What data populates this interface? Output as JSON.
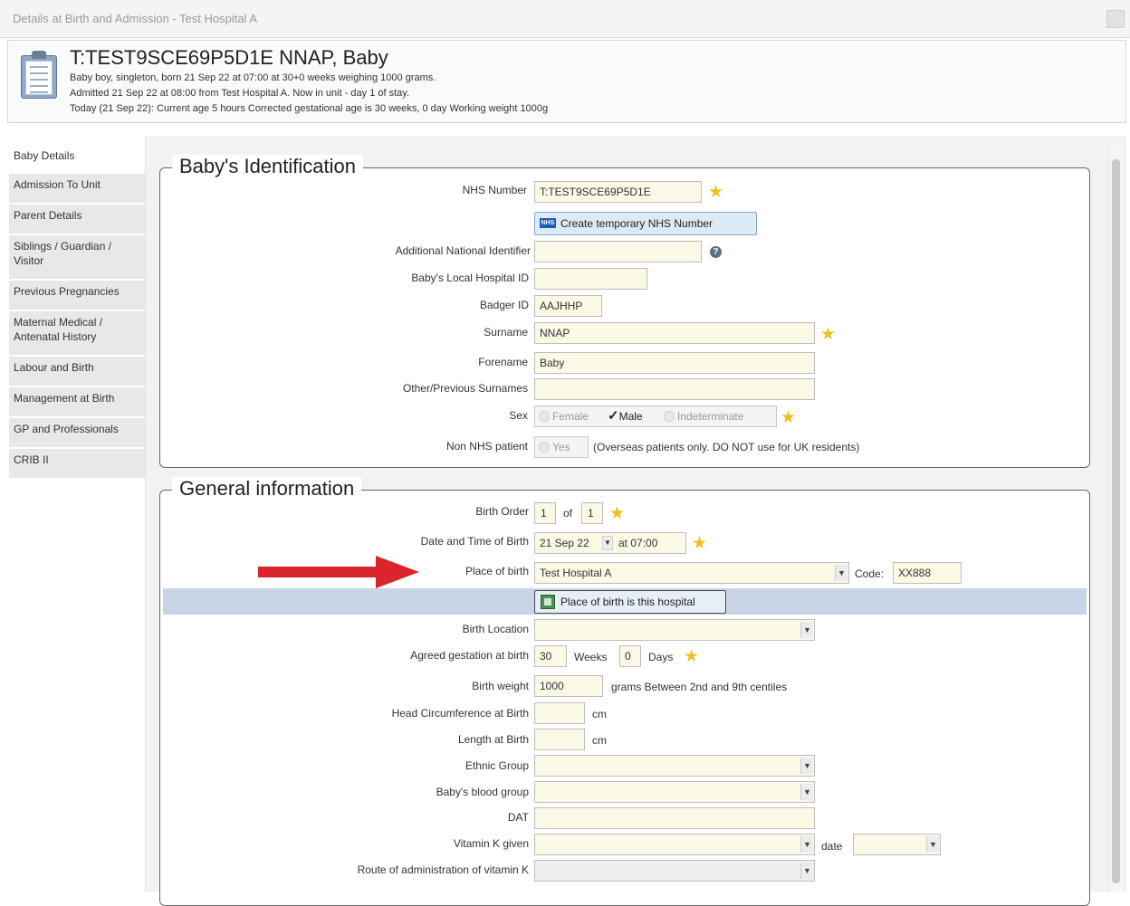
{
  "window": {
    "title": "Details at Birth and Admission - Test Hospital A"
  },
  "patient": {
    "name": "T:TEST9SCE69P5D1E NNAP, Baby",
    "line1": "Baby boy, singleton, born 21 Sep 22 at 07:00 at 30+0 weeks weighing 1000 grams.",
    "line2": "Admitted 21 Sep 22 at 08:00 from Test Hospital A.  Now in unit - day 1 of stay.",
    "line3": "Today (21 Sep 22): Current age 5 hours Corrected gestational age is 30 weeks, 0 day Working weight 1000g"
  },
  "sidebar": {
    "items": [
      {
        "label": "Baby Details"
      },
      {
        "label": "Admission To Unit"
      },
      {
        "label": "Parent Details"
      },
      {
        "label": "Siblings / Guardian / Visitor"
      },
      {
        "label": "Previous Pregnancies"
      },
      {
        "label": "Maternal Medical / Antenatal History"
      },
      {
        "label": "Labour and Birth"
      },
      {
        "label": "Management at Birth"
      },
      {
        "label": "GP and Professionals"
      },
      {
        "label": "CRIB II"
      }
    ]
  },
  "identification": {
    "title": "Baby's Identification",
    "nhs_label": "NHS Number",
    "nhs_value": "T:TEST9SCE69P5D1E",
    "create_nhs_button": "Create temporary NHS Number",
    "nhs_badge": "NHS",
    "additional_id_label": "Additional National Identifier",
    "additional_id_value": "",
    "local_id_label": "Baby's Local Hospital ID",
    "local_id_value": "",
    "badger_label": "Badger ID",
    "badger_value": "AAJHHP",
    "surname_label": "Surname",
    "surname_value": "NNAP",
    "forename_label": "Forename",
    "forename_value": "Baby",
    "other_surnames_label": "Other/Previous Surnames",
    "other_surnames_value": "",
    "sex_label": "Sex",
    "sex_options": {
      "female": "Female",
      "male": "Male",
      "indeterminate": "Indeterminate"
    },
    "sex_selected": "Male",
    "non_nhs_label": "Non NHS patient",
    "non_nhs_yes": "Yes",
    "non_nhs_note": "(Overseas patients only. DO NOT use for UK residents)"
  },
  "general": {
    "title": "General information",
    "birth_order_label": "Birth Order",
    "birth_order_value": "1",
    "birth_order_of": "of",
    "birth_order_total": "1",
    "dob_label": "Date and Time of Birth",
    "dob_date": "21 Sep 22",
    "dob_time": "at 07:00",
    "place_label": "Place of birth",
    "place_value": "Test Hospital A",
    "code_label": "Code:",
    "code_value": "XX888",
    "place_button": "Place of birth is this hospital",
    "location_label": "Birth Location",
    "location_value": "",
    "gestation_label": "Agreed gestation at birth",
    "gestation_weeks": "30",
    "weeks_label": "Weeks",
    "gestation_days": "0",
    "days_label": "Days",
    "weight_label": "Birth weight",
    "weight_value": "1000",
    "weight_note": "grams  Between 2nd and 9th centiles",
    "head_label": "Head Circumference at Birth",
    "head_value": "",
    "cm1": "cm",
    "length_label": "Length at Birth",
    "length_value": "",
    "cm2": "cm",
    "ethnic_label": "Ethnic Group",
    "ethnic_value": "",
    "blood_label": "Baby's blood group",
    "blood_value": "",
    "dat_label": "DAT",
    "dat_value": "",
    "vitk_label": "Vitamin K given",
    "vitk_value": "",
    "vitk_date_label": "date",
    "vitk_date_value": "",
    "route_label": "Route of administration of vitamin K",
    "route_value": ""
  },
  "colors": {
    "field_bg": "#fcf8e6",
    "highlight": "#c9d5e6",
    "arrow": "#d8242a",
    "star": "#f0c020"
  },
  "icons": [
    "clipboard-icon",
    "star-icon",
    "help-icon",
    "nhs-logo-icon",
    "hospital-icon",
    "dropdown-arrow-icon",
    "checkmark-icon",
    "red-arrow-icon"
  ]
}
